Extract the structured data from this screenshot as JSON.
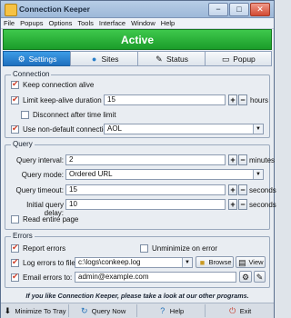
{
  "window": {
    "title": "Connection Keeper",
    "min": "−",
    "max": "□",
    "close": "✕"
  },
  "menu": [
    "File",
    "Popups",
    "Options",
    "Tools",
    "Interface",
    "Window",
    "Help"
  ],
  "status_banner": {
    "text": "Active",
    "color": "#2db23c"
  },
  "tabs": [
    {
      "label": "Settings",
      "icon": "gear-icon",
      "active": true
    },
    {
      "label": "Sites",
      "icon": "globe-icon"
    },
    {
      "label": "Status",
      "icon": "pen-icon"
    },
    {
      "label": "Popup",
      "icon": "window-icon"
    }
  ],
  "connection": {
    "title": "Connection",
    "keep_alive": {
      "label": "Keep connection alive",
      "checked": true
    },
    "limit_duration": {
      "label": "Limit keep-alive duration to:",
      "checked": true,
      "value": "15",
      "unit": "hours"
    },
    "disconnect_after": {
      "label": "Disconnect after time limit",
      "checked": false
    },
    "non_default": {
      "label": "Use non-default connection:",
      "checked": true,
      "value": "AOL"
    }
  },
  "query": {
    "title": "Query",
    "interval": {
      "label": "Query interval:",
      "value": "2",
      "unit": "minutes"
    },
    "mode": {
      "label": "Query mode:",
      "value": "Ordered URL"
    },
    "timeout": {
      "label": "Query timeout:",
      "value": "15",
      "unit": "seconds"
    },
    "initial_delay": {
      "label": "Initial query delay:",
      "value": "10",
      "unit": "seconds"
    },
    "read_entire_page": {
      "label": "Read entire page",
      "checked": false
    }
  },
  "errors": {
    "title": "Errors",
    "report_errors": {
      "label": "Report errors",
      "checked": true
    },
    "unminimize": {
      "label": "Unminimize on error",
      "checked": false
    },
    "log_errors": {
      "label": "Log errors to file:",
      "checked": true,
      "value": "c:\\logs\\conkeep.log",
      "browse": "Browse",
      "view": "View"
    },
    "email_errors": {
      "label": "Email errors to:",
      "checked": true,
      "value": "admin@example.com"
    }
  },
  "footer_message": "If you like Connection Keeper, please take a look at our other programs.",
  "bottom_buttons": [
    {
      "label": "Minimize To Tray",
      "icon": "down-arrow-icon"
    },
    {
      "label": "Query Now",
      "icon": "refresh-icon"
    },
    {
      "label": "Help",
      "icon": "help-icon"
    },
    {
      "label": "Exit",
      "icon": "exit-icon"
    }
  ]
}
